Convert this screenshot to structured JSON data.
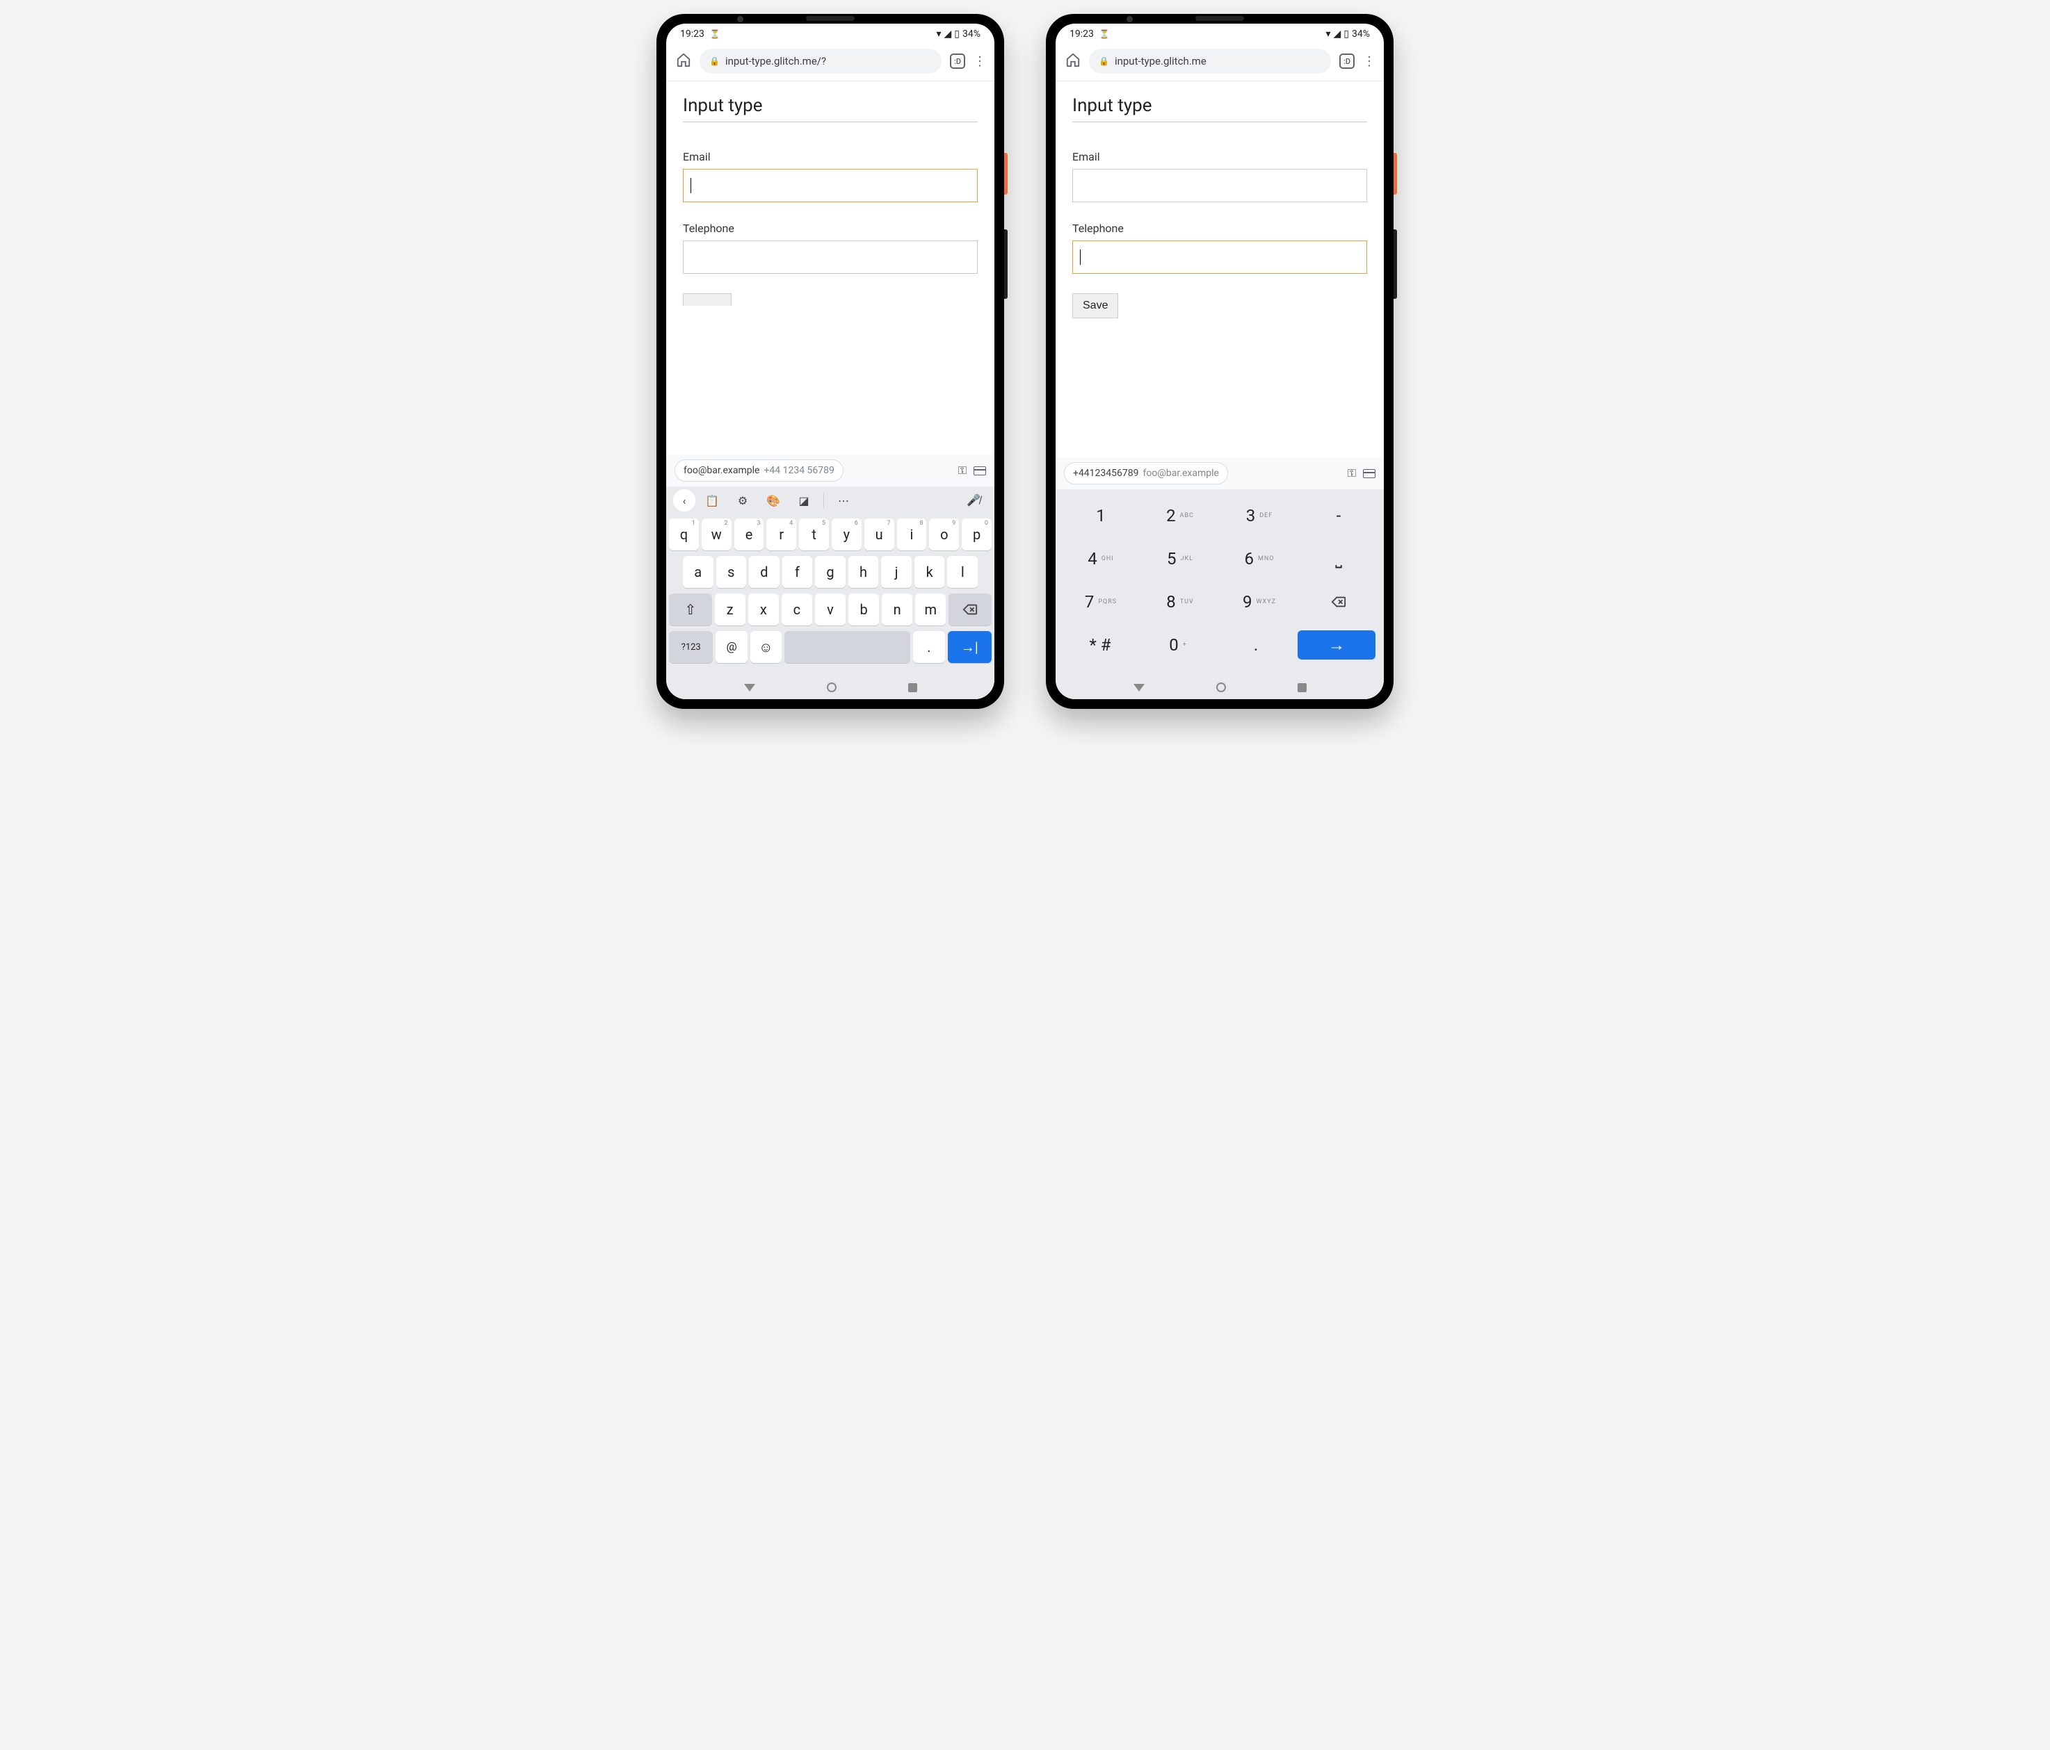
{
  "status": {
    "time": "19:23",
    "battery": "34%"
  },
  "browser": {
    "url_left": "input-type.glitch.me/?",
    "url_right": "input-type.glitch.me",
    "tab_label": ":D"
  },
  "page": {
    "title": "Input type",
    "email_label": "Email",
    "tel_label": "Telephone",
    "save_label": "Save"
  },
  "autofill_left": {
    "primary": "foo@bar.example",
    "secondary": "+44 1234 56789"
  },
  "autofill_right": {
    "primary": "+44123456789",
    "secondary": "foo@bar.example"
  },
  "qwerty": {
    "row1": [
      {
        "k": "q",
        "n": "1"
      },
      {
        "k": "w",
        "n": "2"
      },
      {
        "k": "e",
        "n": "3"
      },
      {
        "k": "r",
        "n": "4"
      },
      {
        "k": "t",
        "n": "5"
      },
      {
        "k": "y",
        "n": "6"
      },
      {
        "k": "u",
        "n": "7"
      },
      {
        "k": "i",
        "n": "8"
      },
      {
        "k": "o",
        "n": "9"
      },
      {
        "k": "p",
        "n": "0"
      }
    ],
    "row2": [
      "a",
      "s",
      "d",
      "f",
      "g",
      "h",
      "j",
      "k",
      "l"
    ],
    "row3": [
      "z",
      "x",
      "c",
      "v",
      "b",
      "n",
      "m"
    ],
    "sym_label": "?123",
    "at_label": "@",
    "dot_label": "."
  },
  "numpad": {
    "rows": [
      [
        {
          "k": "1",
          "l": ""
        },
        {
          "k": "2",
          "l": "ABC"
        },
        {
          "k": "3",
          "l": "DEF"
        },
        {
          "k": "-",
          "l": ""
        }
      ],
      [
        {
          "k": "4",
          "l": "GHI"
        },
        {
          "k": "5",
          "l": "JKL"
        },
        {
          "k": "6",
          "l": "MNO"
        },
        {
          "k": "␣",
          "l": ""
        }
      ],
      [
        {
          "k": "7",
          "l": "PQRS"
        },
        {
          "k": "8",
          "l": "TUV"
        },
        {
          "k": "9",
          "l": "WXYZ"
        }
      ],
      [
        {
          "k": "* #",
          "l": ""
        },
        {
          "k": "0",
          "l": "+"
        },
        {
          "k": ".",
          "l": ""
        }
      ]
    ]
  }
}
